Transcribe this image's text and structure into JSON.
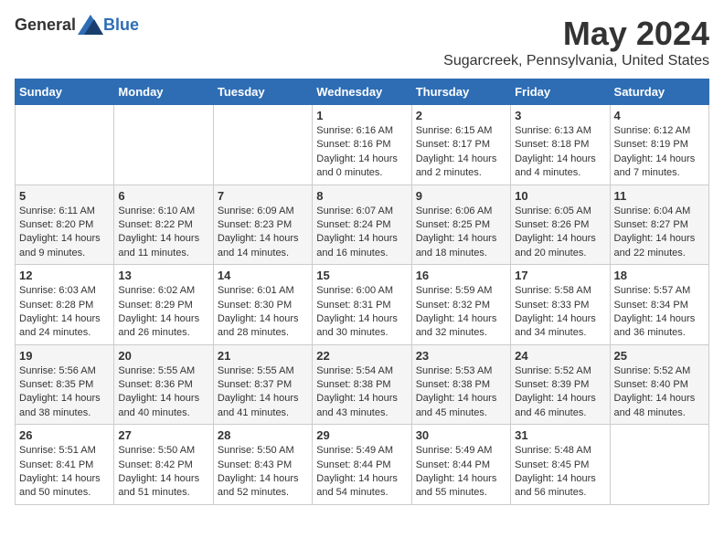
{
  "header": {
    "logo_general": "General",
    "logo_blue": "Blue",
    "month_year": "May 2024",
    "location": "Sugarcreek, Pennsylvania, United States"
  },
  "weekdays": [
    "Sunday",
    "Monday",
    "Tuesday",
    "Wednesday",
    "Thursday",
    "Friday",
    "Saturday"
  ],
  "weeks": [
    [
      {
        "day": "",
        "info": ""
      },
      {
        "day": "",
        "info": ""
      },
      {
        "day": "",
        "info": ""
      },
      {
        "day": "1",
        "info": "Sunrise: 6:16 AM\nSunset: 8:16 PM\nDaylight: 14 hours\nand 0 minutes."
      },
      {
        "day": "2",
        "info": "Sunrise: 6:15 AM\nSunset: 8:17 PM\nDaylight: 14 hours\nand 2 minutes."
      },
      {
        "day": "3",
        "info": "Sunrise: 6:13 AM\nSunset: 8:18 PM\nDaylight: 14 hours\nand 4 minutes."
      },
      {
        "day": "4",
        "info": "Sunrise: 6:12 AM\nSunset: 8:19 PM\nDaylight: 14 hours\nand 7 minutes."
      }
    ],
    [
      {
        "day": "5",
        "info": "Sunrise: 6:11 AM\nSunset: 8:20 PM\nDaylight: 14 hours\nand 9 minutes."
      },
      {
        "day": "6",
        "info": "Sunrise: 6:10 AM\nSunset: 8:22 PM\nDaylight: 14 hours\nand 11 minutes."
      },
      {
        "day": "7",
        "info": "Sunrise: 6:09 AM\nSunset: 8:23 PM\nDaylight: 14 hours\nand 14 minutes."
      },
      {
        "day": "8",
        "info": "Sunrise: 6:07 AM\nSunset: 8:24 PM\nDaylight: 14 hours\nand 16 minutes."
      },
      {
        "day": "9",
        "info": "Sunrise: 6:06 AM\nSunset: 8:25 PM\nDaylight: 14 hours\nand 18 minutes."
      },
      {
        "day": "10",
        "info": "Sunrise: 6:05 AM\nSunset: 8:26 PM\nDaylight: 14 hours\nand 20 minutes."
      },
      {
        "day": "11",
        "info": "Sunrise: 6:04 AM\nSunset: 8:27 PM\nDaylight: 14 hours\nand 22 minutes."
      }
    ],
    [
      {
        "day": "12",
        "info": "Sunrise: 6:03 AM\nSunset: 8:28 PM\nDaylight: 14 hours\nand 24 minutes."
      },
      {
        "day": "13",
        "info": "Sunrise: 6:02 AM\nSunset: 8:29 PM\nDaylight: 14 hours\nand 26 minutes."
      },
      {
        "day": "14",
        "info": "Sunrise: 6:01 AM\nSunset: 8:30 PM\nDaylight: 14 hours\nand 28 minutes."
      },
      {
        "day": "15",
        "info": "Sunrise: 6:00 AM\nSunset: 8:31 PM\nDaylight: 14 hours\nand 30 minutes."
      },
      {
        "day": "16",
        "info": "Sunrise: 5:59 AM\nSunset: 8:32 PM\nDaylight: 14 hours\nand 32 minutes."
      },
      {
        "day": "17",
        "info": "Sunrise: 5:58 AM\nSunset: 8:33 PM\nDaylight: 14 hours\nand 34 minutes."
      },
      {
        "day": "18",
        "info": "Sunrise: 5:57 AM\nSunset: 8:34 PM\nDaylight: 14 hours\nand 36 minutes."
      }
    ],
    [
      {
        "day": "19",
        "info": "Sunrise: 5:56 AM\nSunset: 8:35 PM\nDaylight: 14 hours\nand 38 minutes."
      },
      {
        "day": "20",
        "info": "Sunrise: 5:55 AM\nSunset: 8:36 PM\nDaylight: 14 hours\nand 40 minutes."
      },
      {
        "day": "21",
        "info": "Sunrise: 5:55 AM\nSunset: 8:37 PM\nDaylight: 14 hours\nand 41 minutes."
      },
      {
        "day": "22",
        "info": "Sunrise: 5:54 AM\nSunset: 8:38 PM\nDaylight: 14 hours\nand 43 minutes."
      },
      {
        "day": "23",
        "info": "Sunrise: 5:53 AM\nSunset: 8:38 PM\nDaylight: 14 hours\nand 45 minutes."
      },
      {
        "day": "24",
        "info": "Sunrise: 5:52 AM\nSunset: 8:39 PM\nDaylight: 14 hours\nand 46 minutes."
      },
      {
        "day": "25",
        "info": "Sunrise: 5:52 AM\nSunset: 8:40 PM\nDaylight: 14 hours\nand 48 minutes."
      }
    ],
    [
      {
        "day": "26",
        "info": "Sunrise: 5:51 AM\nSunset: 8:41 PM\nDaylight: 14 hours\nand 50 minutes."
      },
      {
        "day": "27",
        "info": "Sunrise: 5:50 AM\nSunset: 8:42 PM\nDaylight: 14 hours\nand 51 minutes."
      },
      {
        "day": "28",
        "info": "Sunrise: 5:50 AM\nSunset: 8:43 PM\nDaylight: 14 hours\nand 52 minutes."
      },
      {
        "day": "29",
        "info": "Sunrise: 5:49 AM\nSunset: 8:44 PM\nDaylight: 14 hours\nand 54 minutes."
      },
      {
        "day": "30",
        "info": "Sunrise: 5:49 AM\nSunset: 8:44 PM\nDaylight: 14 hours\nand 55 minutes."
      },
      {
        "day": "31",
        "info": "Sunrise: 5:48 AM\nSunset: 8:45 PM\nDaylight: 14 hours\nand 56 minutes."
      },
      {
        "day": "",
        "info": ""
      }
    ]
  ]
}
